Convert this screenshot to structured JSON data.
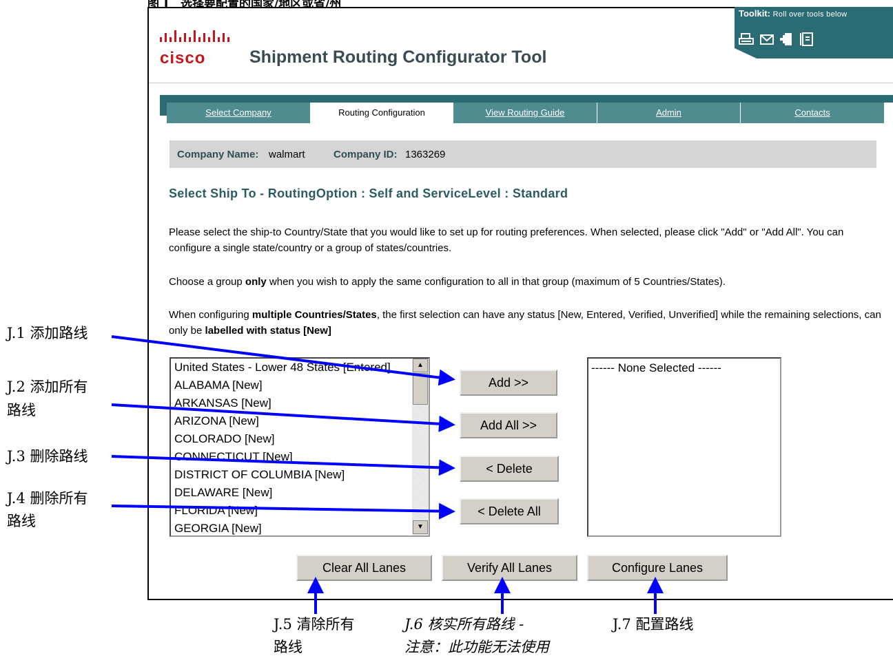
{
  "caption_cut": "图 J　选择要配置的国家/地区或省/州",
  "brand": {
    "logo_text": "cisco",
    "app_title": "Shipment Routing Configurator Tool"
  },
  "toolkit": {
    "label_bold": "Toolkit:",
    "label_rest": "Roll over tools below",
    "icons": [
      "print-icon",
      "email-icon",
      "add-to-favorites-icon",
      "document-icon"
    ]
  },
  "tabs": [
    {
      "label": "Select Company",
      "active": false
    },
    {
      "label": "Routing Configuration",
      "active": true
    },
    {
      "label": "View Routing Guide",
      "active": false
    },
    {
      "label": "Admin",
      "active": false
    },
    {
      "label": "Contacts",
      "active": false
    }
  ],
  "company": {
    "name_label": "Company Name:",
    "name_value": "walmart",
    "id_label": "Company ID:",
    "id_value": "1363269"
  },
  "section_title": "Select Ship To - RoutingOption : Self and ServiceLevel : Standard",
  "instructions": {
    "p1": "Please select the ship-to Country/State that you would like to set up for routing preferences. When selected, please click \"Add\" or \"Add All\". You can configure a single state/country or a group of states/countries.",
    "p2_pre": "Choose a group ",
    "p2_bold": "only",
    "p2_post": " when you wish to apply the same configuration to all in that group (maximum of 5 Countries/States).",
    "p3_a": "When configuring ",
    "p3_b": "multiple Countries/States",
    "p3_c": ", the first selection can have any status [New, Entered, Verified, Unverified] while the remaining selections, can only be ",
    "p3_d": "labelled with status [New]"
  },
  "available_list": [
    "United States - Lower 48 States [Entered]",
    "ALABAMA [New]",
    "ARKANSAS [New]",
    "ARIZONA [New]",
    "COLORADO [New]",
    "CONNECTICUT [New]",
    "DISTRICT OF COLUMBIA [New]",
    "DELAWARE [New]",
    "FLORIDA [New]",
    "GEORGIA [New]"
  ],
  "selected_list_placeholder": "------ None Selected ------",
  "buttons": {
    "add": "Add >>",
    "add_all": "Add All >>",
    "delete": "< Delete",
    "delete_all": "< Delete All",
    "clear_all": "Clear All Lanes",
    "verify_all": "Verify All Lanes",
    "configure": "Configure Lanes"
  },
  "annotations": {
    "j1": "J.1 添加路线",
    "j2_line1": "J.2 添加所有",
    "j2_line2": "路线",
    "j3": "J.3 删除路线",
    "j4_line1": "J.4 删除所有",
    "j4_line2": "路线",
    "j5_line1": "J.5 清除所有",
    "j5_line2": "路线",
    "j6_line1": "J.6 核实所有路线 -",
    "j6_line2": "注意：此功能无法使用",
    "j7": "J.7 配置路线"
  },
  "colors": {
    "teal_dark": "#2b6b73",
    "teal_tab": "#4f8c90",
    "cisco_red": "#c4161c",
    "arrow_blue": "#0000ff",
    "company_bar": "#d4d4d4"
  }
}
